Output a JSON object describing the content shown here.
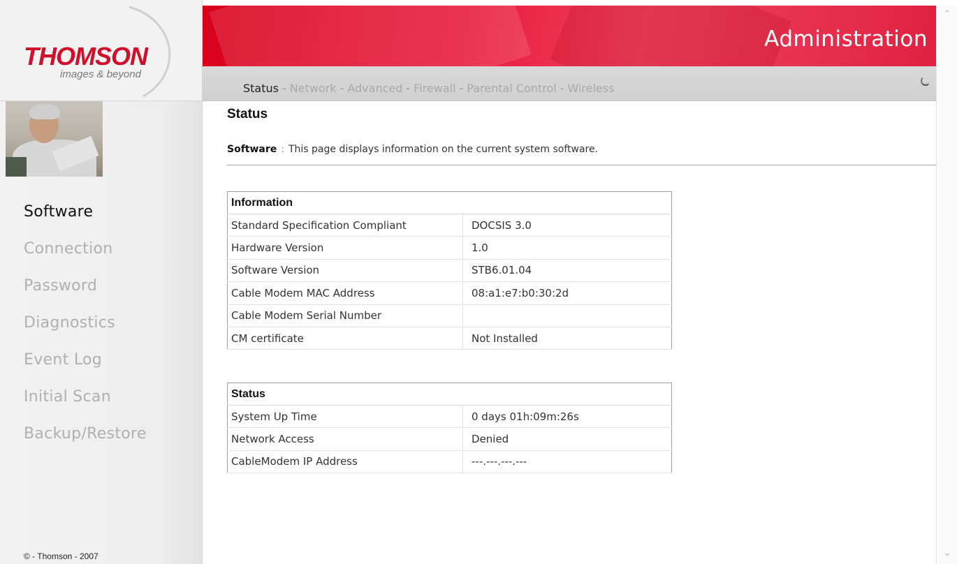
{
  "brand": {
    "logo": "THOMSON",
    "tagline": "images & beyond"
  },
  "header": {
    "title": "Administration"
  },
  "topnav": {
    "items": [
      "Status",
      "Network",
      "Advanced",
      "Firewall",
      "Parental Control",
      "Wireless"
    ],
    "separator": "-",
    "active": "Status"
  },
  "sidebar": {
    "items": [
      "Software",
      "Connection",
      "Password",
      "Diagnostics",
      "Event Log",
      "Initial Scan",
      "Backup/Restore"
    ],
    "active": "Software",
    "copyright": "© - Thomson - 2007"
  },
  "main": {
    "title": "Status",
    "desc_label": "Software",
    "desc_colon": ":",
    "desc_text": "This page displays information on the current system software."
  },
  "information_table": {
    "header": "Information",
    "rows": [
      [
        "Standard Specification Compliant",
        "DOCSIS 3.0"
      ],
      [
        "Hardware Version",
        "1.0"
      ],
      [
        "Software Version",
        "STB6.01.04"
      ],
      [
        "Cable Modem MAC Address",
        "08:a1:e7:b0:30:2d"
      ],
      [
        "Cable Modem Serial Number",
        ""
      ],
      [
        "CM certificate",
        "Not Installed"
      ]
    ]
  },
  "status_table": {
    "header": "Status",
    "rows": [
      [
        "System Up Time",
        "0 days 01h:09m:26s"
      ],
      [
        "Network Access",
        "Denied"
      ],
      [
        "CableModem IP Address",
        "---.---.---.---"
      ]
    ]
  },
  "colors": {
    "brand_red": "#d0102b",
    "banner_red": "#e8173a",
    "nav_gray": "#d3d3d3"
  },
  "icons": {
    "scroll_up": "chevron-up-icon",
    "scroll_down": "chevron-down-icon",
    "loading": "spinner-icon"
  }
}
